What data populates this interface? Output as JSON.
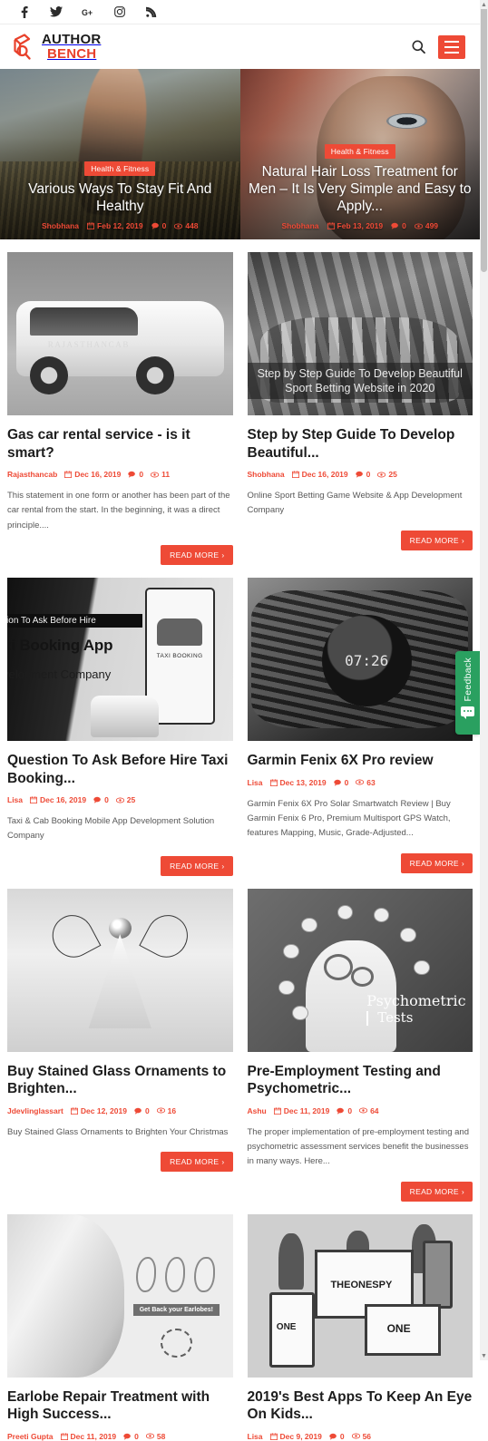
{
  "colors": {
    "accent": "#ee4a36",
    "feedback_green": "#2aa060",
    "title": "#1d1d1d",
    "body_text": "#585858"
  },
  "topbar": {
    "social": [
      {
        "name": "facebook-icon",
        "label": "f"
      },
      {
        "name": "twitter-icon",
        "label": "t"
      },
      {
        "name": "google-plus-icon",
        "label": "G+"
      },
      {
        "name": "instagram-icon",
        "label": "ig"
      },
      {
        "name": "rss-icon",
        "label": "rss"
      }
    ]
  },
  "header": {
    "logo_line1": "AUTHOR",
    "logo_line2": "BENCH",
    "search_label": "Search",
    "menu_label": "Menu"
  },
  "hero": {
    "slides": [
      {
        "category": "Health & Fitness",
        "title": "Various Ways To Stay Fit And Healthy",
        "author": "Shobhana",
        "date": "Feb 12, 2019",
        "comments": "0",
        "views": "448"
      },
      {
        "category": "Health & Fitness",
        "title": "Natural Hair Loss Treatment for Men – It Is Very Simple and Easy to Apply...",
        "author": "Shobhana",
        "date": "Feb 13, 2019",
        "comments": "0",
        "views": "499"
      }
    ]
  },
  "read_more_label": "READ MORE",
  "posts": [
    {
      "title": "Gas car rental service - is it smart?",
      "author": "Rajasthancab",
      "date": "Dec 16, 2019",
      "comments": "0",
      "views": "11",
      "excerpt": "This statement in one form or another has been part of the car rental from the start. In the beginning, it was a direct principle....",
      "thumb_caption": "RAJASTHANCAB"
    },
    {
      "title": "Step by Step Guide To Develop Beautiful...",
      "author": "Shobhana",
      "date": "Dec 16, 2019",
      "comments": "0",
      "views": "25",
      "excerpt": "Online Sport Betting Game Website & App Development Company",
      "thumb_caption": "Step by Step Guide To Develop Beautiful Sport Betting Website in 2020"
    },
    {
      "title": "Question To Ask Before Hire Taxi Booking...",
      "author": "Lisa",
      "date": "Dec 16, 2019",
      "comments": "0",
      "views": "25",
      "excerpt": "Taxi & Cab Booking Mobile App Development Solution Company",
      "thumb_caption": "Question To Ask Before Hire Taxi Booking App Development Company",
      "thumb_phone_label": "TAXI BOOKING"
    },
    {
      "title": "Garmin Fenix 6X Pro review",
      "author": "Lisa",
      "date": "Dec 13, 2019",
      "comments": "0",
      "views": "63",
      "excerpt": "Garmin Fenix 6X Pro Solar Smartwatch Review | Buy Garmin Fenix 6 Pro, Premium Multisport GPS Watch, features Mapping, Music, Grade-Adjusted...",
      "thumb_caption": "07:26"
    },
    {
      "title": "Buy Stained Glass Ornaments to Brighten...",
      "author": "Jdevlinglassart",
      "date": "Dec 12, 2019",
      "comments": "0",
      "views": "16",
      "excerpt": "Buy Stained Glass Ornaments to Brighten Your Christmas",
      "thumb_caption": ""
    },
    {
      "title": "Pre-Employment Testing and Psychometric...",
      "author": "Ashu",
      "date": "Dec 11, 2019",
      "comments": "0",
      "views": "64",
      "excerpt": "The proper implementation of pre-employment testing and psychometric assessment services benefit the businesses in many ways. Here...",
      "thumb_caption": "Psychometric",
      "thumb_caption2": "Tests"
    },
    {
      "title": "Earlobe Repair Treatment with High Success...",
      "author": "Preeti Gupta",
      "date": "Dec 11, 2019",
      "comments": "0",
      "views": "58",
      "excerpt": "",
      "thumb_caption": "Get Back your Earlobes!"
    },
    {
      "title": "2019's Best Apps To Keep An Eye On Kids...",
      "author": "Lisa",
      "date": "Dec 9, 2019",
      "comments": "0",
      "views": "56",
      "excerpt": "",
      "thumb_caption": "ONE",
      "thumb_caption2": "THEONESPY"
    }
  ],
  "feedback": {
    "label": "Feedback"
  }
}
